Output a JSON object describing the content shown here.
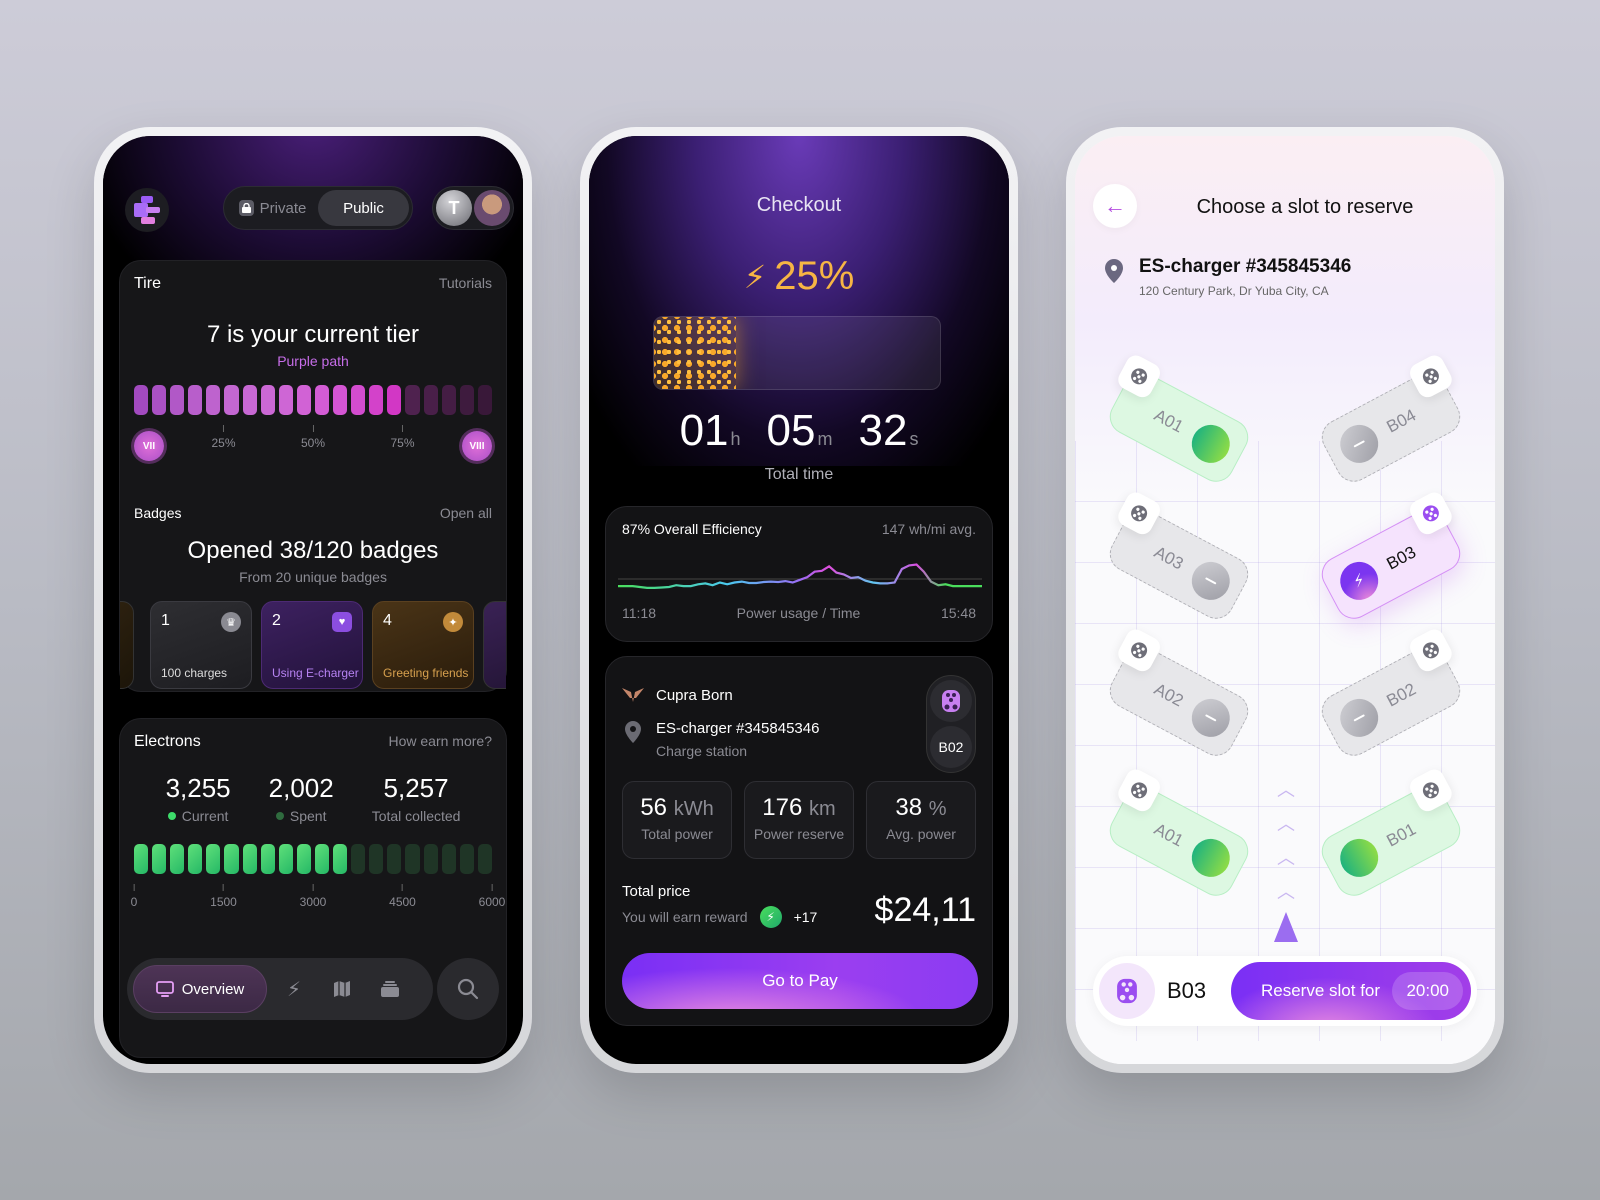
{
  "overview": {
    "privacy_toggle": {
      "private_label": "Private",
      "public_label": "Public",
      "selected": "Public"
    },
    "tier": {
      "title": "Tire",
      "link": "Tutorials",
      "headline": "7 is your current tier",
      "path": "Purple path",
      "filled_fraction": 0.75,
      "segments_total": 20,
      "segments_filled": 15,
      "start_badge": "VII",
      "end_badge": "VIII",
      "ticks": [
        "25%",
        "50%",
        "75%"
      ]
    },
    "badges": {
      "title": "Badges",
      "link": "Open all",
      "headline": "Opened 38/120 badges",
      "sub": "From 20 unique badges",
      "items": [
        {
          "count": "1",
          "label": "100 charges",
          "icon": "crown-icon",
          "tone": "gray"
        },
        {
          "count": "2",
          "label": "Using E-charger",
          "icon": "heart-shield-icon",
          "tone": "purple"
        },
        {
          "count": "4",
          "label": "Greeting friends",
          "icon": "sparkle-icon",
          "tone": "gold"
        }
      ]
    },
    "electrons": {
      "title": "Electrons",
      "link": "How earn more?",
      "stats": [
        {
          "value": "3,255",
          "label": "Current",
          "dot": "#3ddc6a"
        },
        {
          "value": "2,002",
          "label": "Spent",
          "dot": "#2f6b3e"
        },
        {
          "value": "5,257",
          "label": "Total collected",
          "dot": ""
        }
      ],
      "segments_total": 20,
      "segments_filled": 12,
      "ticks": [
        "0",
        "1500",
        "3000",
        "4500",
        "6000"
      ]
    },
    "nav": {
      "overview_label": "Overview"
    }
  },
  "checkout": {
    "title": "Checkout",
    "charge_percent": "25%",
    "charge_fraction": 0.25,
    "timer": {
      "h": "01",
      "h_unit": "h",
      "m": "05",
      "m_unit": "m",
      "s": "32",
      "s_unit": "s",
      "label": "Total time"
    },
    "efficiency": {
      "title": "87% Overall Efficiency",
      "avg": "147 wh/mi avg.",
      "start": "11:18",
      "caption": "Power usage / Time",
      "end": "15:48",
      "series": [
        0.42,
        0.42,
        0.42,
        0.4,
        0.38,
        0.38,
        0.39,
        0.4,
        0.44,
        0.42,
        0.42,
        0.46,
        0.48,
        0.44,
        0.5,
        0.46,
        0.5,
        0.52,
        0.49,
        0.49,
        0.51,
        0.52,
        0.51,
        0.53,
        0.5,
        0.56,
        0.62,
        0.74,
        0.76,
        0.86,
        0.72,
        0.68,
        0.6,
        0.62,
        0.54,
        0.5,
        0.48,
        0.48,
        0.5,
        0.8,
        0.88,
        0.9,
        0.74,
        0.52,
        0.44,
        0.46,
        0.42,
        0.42,
        0.42,
        0.42,
        0.42
      ]
    },
    "vehicle": "Cupra Born",
    "station": "ES-charger #345845346",
    "station_type": "Charge station",
    "slot": "B02",
    "metrics": [
      {
        "value": "56",
        "unit": "kWh",
        "label": "Total power"
      },
      {
        "value": "176",
        "unit": "km",
        "label": "Power reserve"
      },
      {
        "value": "38",
        "unit": "%",
        "label": "Avg. power"
      }
    ],
    "price_label": "Total price",
    "reward_label": "You will earn reward",
    "reward_value": "+17",
    "price": "$24,11",
    "pay_label": "Go to Pay"
  },
  "reserve": {
    "title": "Choose a slot to reserve",
    "station": "ES-charger #345845346",
    "address": "120 Century Park, Dr Yuba City, CA",
    "slots": [
      {
        "id": "A01",
        "status": "free",
        "side": "left",
        "row": 0
      },
      {
        "id": "B04",
        "status": "busy",
        "side": "right",
        "row": 0
      },
      {
        "id": "A03",
        "status": "busy",
        "side": "left",
        "row": 1
      },
      {
        "id": "B03",
        "status": "selected",
        "side": "right",
        "row": 1
      },
      {
        "id": "A02",
        "status": "busy",
        "side": "left",
        "row": 2
      },
      {
        "id": "B02",
        "status": "busy",
        "side": "right",
        "row": 2
      },
      {
        "id": "A01",
        "status": "free",
        "side": "left",
        "row": 3
      },
      {
        "id": "B01",
        "status": "free",
        "side": "right",
        "row": 3
      }
    ],
    "selected_slot": "B03",
    "reserve_label": "Reserve slot for",
    "reserve_time": "20:00"
  }
}
